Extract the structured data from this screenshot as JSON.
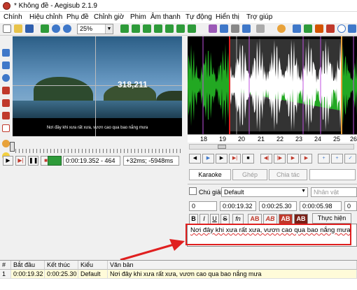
{
  "window": {
    "title": "* Không đề - Aegisub 2.1.9"
  },
  "menu": [
    "Chính",
    "Hiệu chỉnh",
    "Phụ đề",
    "Chỉnh giờ",
    "Phim",
    "Âm thanh",
    "Tự động",
    "Hiển thị",
    "Trợ giúp"
  ],
  "toolbar": {
    "zoom": "25%"
  },
  "video": {
    "coordinate": "318,211",
    "subtitle": "Nơi đây khi xưa rất xưa, vươn cao qua bao nắng mưa",
    "time": "0:00:19.352 - 464",
    "offset": "+32ms; -5948ms"
  },
  "audio": {
    "ticks": [
      "18",
      "19",
      "20",
      "21",
      "22",
      "23",
      "24",
      "25",
      "26"
    ]
  },
  "tabs": {
    "karaoke": "Karaoke",
    "ghep": "Ghép",
    "chia": "Chia tác"
  },
  "editor": {
    "comment_label": "Chú giải",
    "style": "Default",
    "actor_placeholder": "Nhân vật",
    "layer": "0",
    "start": "0:00:19.32",
    "end": "0:00:25.30",
    "duration": "0:00:05.98",
    "margin": "0",
    "commit": "Thực hiện",
    "text": "Nơi đây khi xưa rất xưa, vươn cao qua bao nắng mưa",
    "fmt": [
      "B",
      "I",
      "U",
      "S",
      "fn",
      "AB",
      "AB",
      "AB",
      "AB"
    ]
  },
  "grid": {
    "headers": [
      "#",
      "Bắt đầu",
      "Kết thúc",
      "Kiểu dáng",
      "Văn bản"
    ],
    "rows": [
      {
        "num": "1",
        "start": "0:00:19.32",
        "end": "0:00:25.30",
        "style": "Default",
        "text": "Nơi đây khi xưa rất xưa, vươn cao qua bao nắng mưa"
      }
    ]
  },
  "colors": {
    "accent_red": "#e02020",
    "waveform_green": "#22a822",
    "row_highlight": "#fffbd9"
  }
}
